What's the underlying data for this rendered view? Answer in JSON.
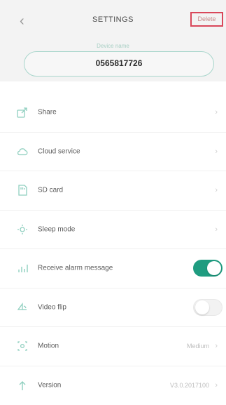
{
  "header": {
    "back_icon": "chevron-left-icon",
    "title": "SETTINGS",
    "delete_label": "Delete",
    "device_label": "Device name",
    "device_name": "0565817726"
  },
  "colors": {
    "accent": "#1f9c80",
    "icon": "#8fcfbf",
    "delete_border": "#d9475a"
  },
  "settings": [
    {
      "label": "Share",
      "icon": "share-icon",
      "control": "chevron"
    },
    {
      "label": "Cloud service",
      "icon": "cloud-icon",
      "control": "chevron"
    },
    {
      "label": "SD card",
      "icon": "sd-card-icon",
      "control": "chevron"
    },
    {
      "label": "Sleep mode",
      "icon": "sleep-icon",
      "control": "chevron"
    },
    {
      "label": "Receive alarm message",
      "icon": "alarm-icon",
      "control": "toggle",
      "on": true
    },
    {
      "label": "Video flip",
      "icon": "flip-icon",
      "control": "toggle",
      "on": false
    },
    {
      "label": "Motion",
      "icon": "motion-icon",
      "control": "value",
      "value": "Medium"
    },
    {
      "label": "Version",
      "icon": "version-icon",
      "control": "value",
      "value": "V3.0.2017100"
    }
  ]
}
